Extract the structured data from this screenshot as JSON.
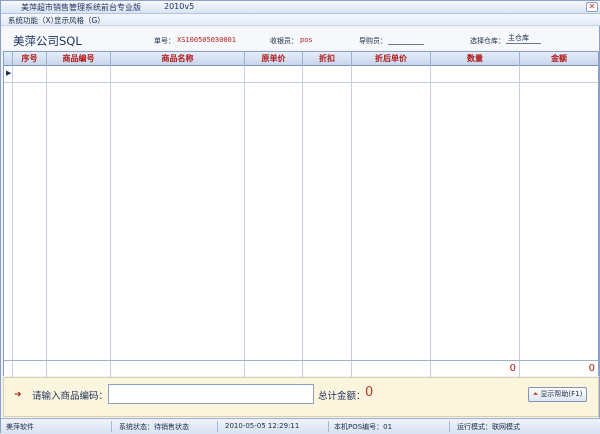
{
  "window": {
    "title": "美萍超市销售管理系统前台专业版",
    "version": "2010v5",
    "close_label": "✕"
  },
  "menu": [
    {
      "label": "系统功能（X）"
    },
    {
      "label": "显示风格（G）"
    }
  ],
  "info": {
    "company": "美萍公司SQL",
    "order_no_label": "单号：",
    "order_no": "XS100505030001",
    "cashier_label": "收银员：",
    "cashier": "pos",
    "guide_label": "导购员：",
    "guide": "",
    "warehouse_label": "选择仓库：",
    "warehouse": "主仓库"
  },
  "table": {
    "columns": [
      "序号",
      "商品编号",
      "商品名称",
      "原单价",
      "折扣",
      "折后单价",
      "数量",
      "金额"
    ],
    "rows": [],
    "totals": {
      "quantity": "0",
      "amount": "0"
    }
  },
  "input": {
    "prompt": "请输入商品编码：",
    "value": "",
    "sum_label": "总计金额：",
    "sum_value": "0",
    "help_label": "显示帮助(F1)"
  },
  "status": {
    "company": "美萍软件",
    "state": "系统状态：待销售状态",
    "datetime": "2010-05-05  12:29:11",
    "pos": "本机POS编号：01",
    "mode": "运行模式：联网模式"
  },
  "colors": {
    "accent_red": "#b01818",
    "header_bg": "#c7d5ec",
    "input_bg": "#fbf5dd"
  }
}
